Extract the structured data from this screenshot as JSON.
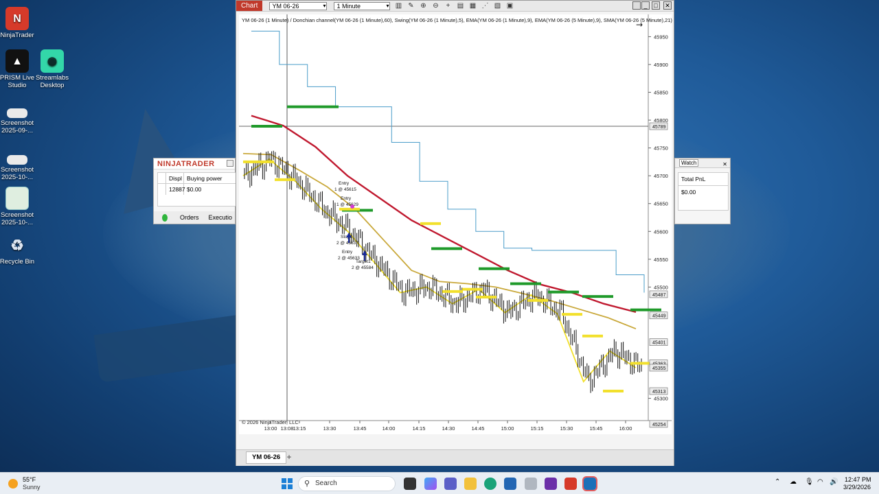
{
  "desktop": {
    "icons": [
      {
        "label": "NinjaTrader"
      },
      {
        "label": "PRISM Live Studio"
      },
      {
        "label": "Streamlabs Desktop"
      },
      {
        "label": "Screenshot 2025-09-..."
      },
      {
        "label": "Screenshot 2025-10-..."
      },
      {
        "label": "Screenshot 2025-10-..."
      },
      {
        "label": "Recycle Bin"
      }
    ]
  },
  "chart_window": {
    "title_tab": "Chart",
    "instrument_select": "YM 06-26",
    "interval_select": "1 Minute",
    "header_text": "YM 06-26 (1 Minute) / Donchian channel(YM 06-26 (1 Minute),60), Swing(YM 06-26 (1 Minute),5), EMA(YM 06-26 (1 Minute),9), EMA(YM 06-26 (5 Minute),9), SMA(YM 06-26 (5 Minute),21)",
    "copyright": "© 2026 NinjaTrader, LLC",
    "bottom_tab": "YM 06-26",
    "add_tab": "+"
  },
  "chart_data": {
    "type": "line",
    "title": "YM 06-26 (1 Minute)",
    "x_ticks": [
      "13:00",
      "13:08",
      "13:15",
      "13:30",
      "13:45",
      "14:00",
      "14:15",
      "14:30",
      "14:45",
      "15:00",
      "15:15",
      "15:30",
      "15:45",
      "16:00"
    ],
    "y_ticks": [
      45950,
      45900,
      45850,
      45800,
      45750,
      45700,
      45650,
      45600,
      45550,
      45500,
      45300
    ],
    "ylim": [
      45260,
      45990
    ],
    "price_markers": [
      45789,
      45487,
      45449,
      45401,
      45363,
      45355,
      45313,
      45254
    ],
    "crosshair": {
      "time": "13:08",
      "price": 45789
    },
    "annotations": [
      {
        "text": "Entry",
        "sub": "1 @ 45615"
      },
      {
        "text": "Entry",
        "sub": "1 @ 45629"
      },
      {
        "text": "Stop1",
        "sub": "2 @ 45637"
      },
      {
        "text": "Entry",
        "sub": "2 @ 45633"
      },
      {
        "text": "Target1",
        "sub": "2 @ 45584"
      }
    ],
    "series": [
      {
        "name": "Donchian channel",
        "color": "#4a9cc9",
        "values": [
          45960,
          45900,
          45860,
          45824,
          45824,
          45760,
          45690,
          45640,
          45600,
          45570,
          45566,
          45566,
          45566,
          45522,
          45490
        ]
      },
      {
        "name": "SMA(YM 06-26 (5 Minute),21)",
        "color": "#c0192f",
        "values": [
          45808,
          45790,
          45752,
          45700,
          45660,
          45620,
          45590,
          45560,
          45530,
          45505,
          45490,
          45470,
          45455
        ]
      },
      {
        "name": "EMA(YM 06-26 (5 Minute),9)",
        "color": "#c9a83a",
        "values": [
          45740,
          45738,
          45710,
          45680,
          45640,
          45585,
          45530,
          45510,
          45506,
          45500,
          45488,
          45475,
          45460,
          45445,
          45425
        ]
      },
      {
        "name": "EMA(YM 06-26 (1 Minute),9)",
        "color": "#f2e02c",
        "values": [
          45700,
          45730,
          45690,
          45640,
          45600,
          45545,
          45490,
          45500,
          45470,
          45496,
          45454,
          45486,
          45452,
          45330,
          45385,
          45355
        ]
      }
    ],
    "swing_highs": [
      45789,
      45824,
      45638,
      45569,
      45533,
      45506,
      45491,
      45483,
      45459
    ],
    "swing_lows": [
      45725,
      45693,
      45640,
      45614,
      45482,
      45492,
      45496,
      45476,
      45451,
      45412,
      45313,
      45363
    ]
  },
  "nt_control": {
    "title": "NINJATRADER",
    "columns": [
      "Displ",
      "Buying power"
    ],
    "row": [
      "12887",
      "$0.00"
    ],
    "tabs": [
      "Orders",
      "Executio"
    ]
  },
  "watch_panel": {
    "title": "Watch",
    "column": "Total PnL",
    "value": "$0.00"
  },
  "taskbar": {
    "weather_temp": "55°F",
    "weather_cond": "Sunny",
    "search_placeholder": "Search",
    "time": "12:47 PM",
    "date": "3/29/2026"
  }
}
